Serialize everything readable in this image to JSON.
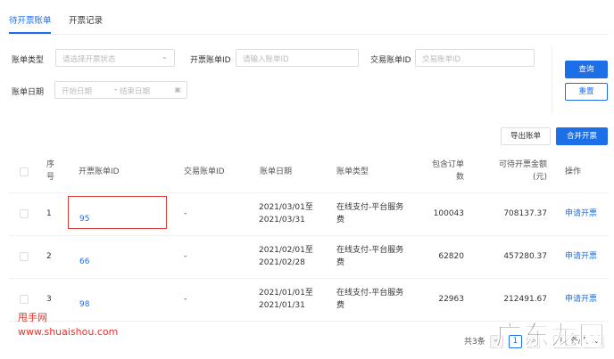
{
  "tabs": [
    {
      "label": "待开票账单"
    },
    {
      "label": "开票记录"
    }
  ],
  "filters": {
    "bill_type_label": "账单类型",
    "bill_type_placeholder": "请选择开票状态",
    "invoice_id_label": "开票账单ID",
    "invoice_id_placeholder": "请输入账单ID",
    "trade_id_label": "交易账单ID",
    "trade_id_placeholder": "交易账单ID",
    "date_label": "账单日期",
    "start_placeholder": "开始日期",
    "separator": "-",
    "end_placeholder": "结束日期"
  },
  "buttons": {
    "query": "查询",
    "reset": "重置",
    "export": "导出账单",
    "merge": "合并开票"
  },
  "table": {
    "headers": {
      "seq": "序号",
      "invoice_id": "开票账单ID",
      "trade_id": "交易账单ID",
      "date": "账单日期",
      "type": "账单类型",
      "orders": "包含订单数",
      "amount": "可待开票金额(元)",
      "action": "操作"
    },
    "rows": [
      {
        "seq": "1",
        "invoice_id": "95",
        "trade_id": "-",
        "date_from": "2021/03/01至",
        "date_to": "2021/03/31",
        "type": "在线支付-平台服务费",
        "orders": "100043",
        "amount": "708137.37",
        "action": "申请开票"
      },
      {
        "seq": "2",
        "invoice_id": "66",
        "trade_id": "-",
        "date_from": "2021/02/01至",
        "date_to": "2021/02/28",
        "type": "在线支付-平台服务费",
        "orders": "62820",
        "amount": "457280.37",
        "action": "申请开票"
      },
      {
        "seq": "3",
        "invoice_id": "98",
        "trade_id": "-",
        "date_from": "2021/01/01至",
        "date_to": "2021/01/31",
        "type": "在线支付-平台服务费",
        "orders": "22963",
        "amount": "212491.67",
        "action": "申请开票"
      }
    ]
  },
  "pagination": {
    "total": "共3条",
    "prev": "<",
    "page": "1",
    "next": ">",
    "page_size": "10 条/页"
  },
  "watermarks": {
    "site_name": "甩手网",
    "site_url": "www.shuaishou.com",
    "brand": "广东龙网"
  }
}
